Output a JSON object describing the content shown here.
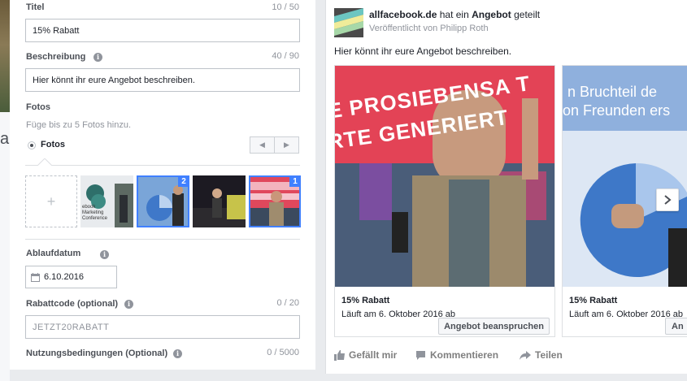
{
  "left_strip": {
    "char": "a"
  },
  "form": {
    "title": {
      "label": "Titel",
      "counter": "10 / 50",
      "value": "15% Rabatt"
    },
    "description": {
      "label": "Beschreibung",
      "counter": "40 / 90",
      "value": "Hier könnt ihr eure Angebot beschreiben."
    },
    "photos": {
      "label": "Fotos",
      "hint": "Füge bis zu 5 Fotos hinzu.",
      "radio_label": "Fotos",
      "add_symbol": "+",
      "nav_prev": "◀",
      "nav_next": "▶",
      "thumb_text": "ebook Marketing Conference",
      "badges": [
        "2",
        "1"
      ]
    },
    "expiry": {
      "label": "Ablaufdatum",
      "value": "6.10.2016"
    },
    "code": {
      "label": "Rabattcode (optional)",
      "counter": "0 / 20",
      "placeholder": "JETZT20RABATT"
    },
    "terms": {
      "label": "Nutzungsbedingungen (Optional)",
      "counter": "0 / 5000"
    }
  },
  "preview": {
    "page_name": "allfacebook.de",
    "shared_mid": "hat ein",
    "shared_obj": "Angebot",
    "shared_end": "geteilt",
    "published_by": "Veröffentlicht von Philipp Roth",
    "body": "Hier könnt ihr eure Angebot beschreiben.",
    "cards": [
      {
        "title": "15% Rabatt",
        "subtitle": "Läuft am 6. Oktober 2016 ab",
        "cta": "Angebot beanspruchen",
        "banner": "E PROSIEBENSA T",
        "banner2": "RTE GENERIERT"
      },
      {
        "title": "15% Rabatt",
        "subtitle": "Läuft am 6. Oktober 2016 ab",
        "cta": "An",
        "banner": "n Bruchteil de",
        "banner2": "on Freunden ers"
      }
    ],
    "actions": {
      "like": "Gefällt mir",
      "comment": "Kommentieren",
      "share": "Teilen"
    }
  },
  "colors": {
    "accent": "#4080ff",
    "link": "#365899",
    "panel_bg": "#e9ebee"
  }
}
